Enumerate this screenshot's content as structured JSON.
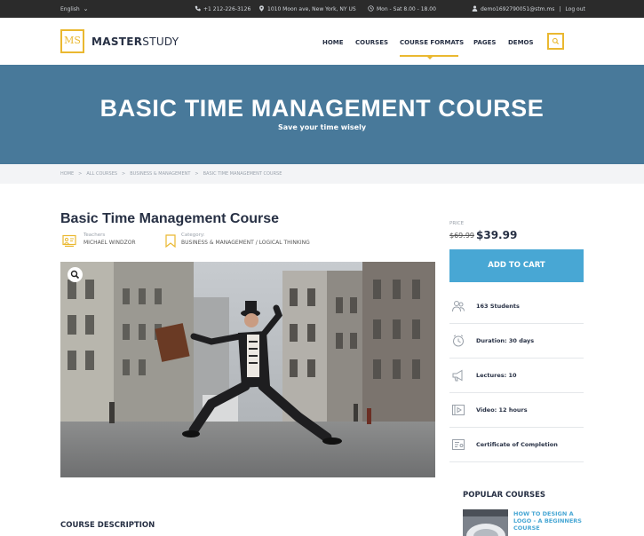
{
  "topbar": {
    "language": "English",
    "phone": "+1 212-226-3126",
    "address": "1010 Moon ave, New York, NY US",
    "hours": "Mon - Sat 8.00 - 18.00",
    "user_email": "demo1692790051@stm.ms",
    "logout": "Log out"
  },
  "header": {
    "logo_mark": "MS",
    "logo_bold": "MASTER",
    "logo_light": "STUDY",
    "nav": [
      "HOME",
      "COURSES",
      "COURSE FORMATS",
      "PAGES",
      "DEMOS"
    ],
    "active_nav": "COURSE FORMATS"
  },
  "banner": {
    "title": "BASIC TIME MANAGEMENT COURSE",
    "subtitle": "Save your time wisely"
  },
  "breadcrumb": [
    "HOME",
    "ALL COURSES",
    "BUSINESS & MANAGEMENT",
    "BASIC TIME MANAGEMENT COURSE"
  ],
  "course": {
    "title": "Basic Time Management Course",
    "teacher_label": "Teachers",
    "teacher": "MICHAEL WINDZOR",
    "category_label": "Category:",
    "categories": "BUSINESS & MANAGEMENT  /  LOGICAL THINKING",
    "description_title": "COURSE DESCRIPTION"
  },
  "sidebar": {
    "price_label": "PRICE",
    "old_price": "$69.99",
    "new_price": "$39.99",
    "add_to_cart": "ADD TO CART",
    "features": [
      {
        "icon": "students-icon",
        "text": "163 Students"
      },
      {
        "icon": "clock-icon",
        "text": "Duration: 30 days"
      },
      {
        "icon": "megaphone-icon",
        "text": "Lectures: 10"
      },
      {
        "icon": "video-icon",
        "text": "Video: 12 hours"
      },
      {
        "icon": "certificate-icon",
        "text": "Certificate of Completion"
      }
    ],
    "popular_title": "POPULAR COURSES",
    "popular_items": [
      {
        "title": "HOW TO DESIGN A LOGO - A BEGINNERS COURSE"
      }
    ]
  },
  "colors": {
    "accent_yellow": "#eab830",
    "banner_blue": "#48799a",
    "cart_blue": "#48a7d4",
    "topbar_dark": "#2b2b2b"
  }
}
